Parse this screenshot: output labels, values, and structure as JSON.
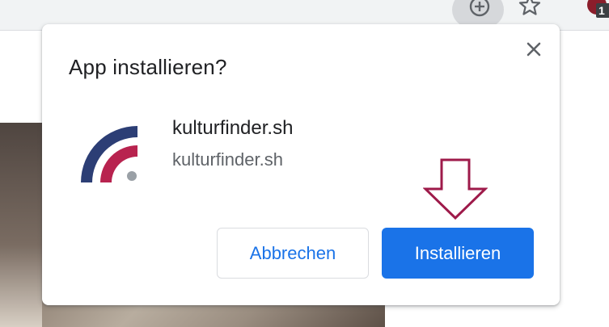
{
  "dialog": {
    "title": "App installieren?",
    "app_name": "kulturfinder.sh",
    "app_origin": "kulturfinder.sh",
    "cancel_label": "Abbrechen",
    "install_label": "Installieren"
  },
  "toolbar": {
    "extension_badge": "1"
  },
  "icons": {
    "install": "plus-circle-icon",
    "bookmark": "star-icon",
    "close": "close-icon",
    "annotation": "down-arrow-icon"
  },
  "colors": {
    "primary": "#1a73e8",
    "logo_navy": "#2c3e75",
    "logo_crimson": "#b8234f",
    "logo_grey": "#9aa0a6",
    "annotation_arrow": "#9e1a4a"
  }
}
